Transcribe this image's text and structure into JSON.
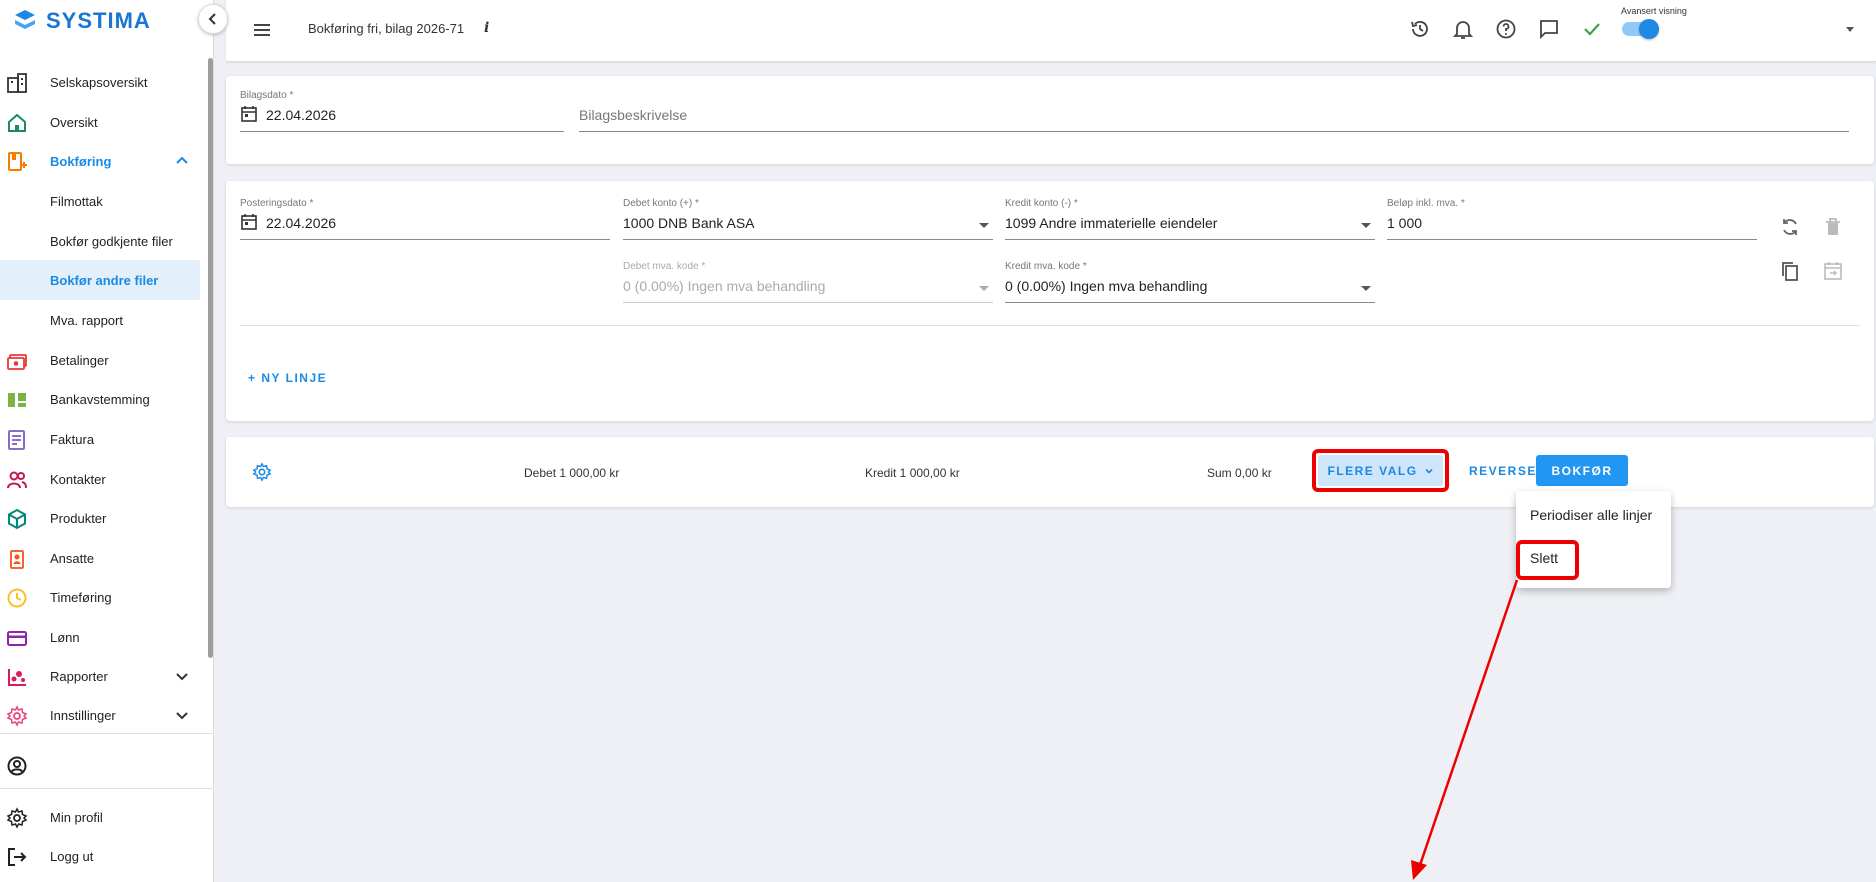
{
  "app": {
    "logo_text": "SYSTIMA"
  },
  "sidebar": {
    "items": [
      {
        "label": "Selskapsoversikt",
        "icon": "buildings-icon"
      },
      {
        "label": "Oversikt",
        "icon": "home-icon"
      },
      {
        "label": "Bokføring",
        "icon": "bookkeeping-icon",
        "expanded": true
      },
      {
        "label": "Filmottak"
      },
      {
        "label": "Bokfør godkjente filer"
      },
      {
        "label": "Bokfør andre filer",
        "active": true
      },
      {
        "label": "Mva. rapport"
      },
      {
        "label": "Betalinger",
        "icon": "payments-icon"
      },
      {
        "label": "Bankavstemming",
        "icon": "bank-reconcile-icon"
      },
      {
        "label": "Faktura",
        "icon": "invoice-icon"
      },
      {
        "label": "Kontakter",
        "icon": "contacts-icon"
      },
      {
        "label": "Produkter",
        "icon": "products-icon"
      },
      {
        "label": "Ansatte",
        "icon": "employees-icon"
      },
      {
        "label": "Timeføring",
        "icon": "clock-icon"
      },
      {
        "label": "Lønn",
        "icon": "payroll-icon"
      },
      {
        "label": "Rapporter",
        "icon": "reports-icon"
      },
      {
        "label": "Innstillinger",
        "icon": "settings-icon"
      }
    ],
    "footer": {
      "profile": "Min profil",
      "logout": "Logg ut"
    }
  },
  "header": {
    "title": "Bokføring fri, bilag 2026-71",
    "info": "i",
    "advanced_label": "Avansert visning",
    "advanced_on": true
  },
  "voucher": {
    "date_label": "Bilagsdato *",
    "date_value": "22.04.2026",
    "description_placeholder": "Bilagsbeskrivelse"
  },
  "posting": {
    "date_label": "Posteringsdato *",
    "date_value": "22.04.2026",
    "debit_account_label": "Debet konto (+) *",
    "debit_account_value": "1000 DNB Bank ASA",
    "credit_account_label": "Kredit konto (-) *",
    "credit_account_value": "1099 Andre immaterielle eiendeler",
    "amount_label": "Beløp inkl. mva. *",
    "amount_value": "1 000",
    "debit_vat_label": "Debet mva. kode *",
    "debit_vat_value": "0 (0.00%) Ingen mva behandling",
    "credit_vat_label": "Kredit mva. kode *",
    "credit_vat_value": "0 (0.00%) Ingen mva behandling",
    "new_line": "+ NY LINJE"
  },
  "summary": {
    "debit": "Debet 1 000,00 kr",
    "credit": "Kredit 1 000,00 kr",
    "sum": "Sum 0,00 kr",
    "more_options": "FLERE VALG",
    "reverse": "REVERSER",
    "book": "BOKFØR"
  },
  "more_menu": {
    "items": [
      "Periodiser alle linjer",
      "Slett"
    ]
  },
  "colors": {
    "accent": "#1a8ae5",
    "primary_button": "#2196f3",
    "highlight": "#ee0000"
  }
}
